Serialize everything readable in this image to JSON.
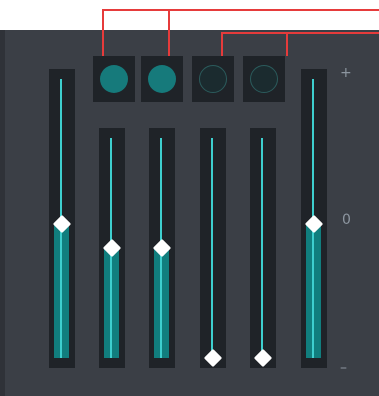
{
  "scale": {
    "plus": "+",
    "zero": "0",
    "minus": "–"
  },
  "leds": [
    {
      "state": "on"
    },
    {
      "state": "on"
    },
    {
      "state": "off"
    },
    {
      "state": "off"
    }
  ],
  "sliders": [
    {
      "value": 0.48
    },
    {
      "value": 0.5
    },
    {
      "value": 0.5
    },
    {
      "value": 0.0
    },
    {
      "value": 0.0
    },
    {
      "value": 0.48
    }
  ],
  "colors": {
    "background": "#3b3f46",
    "track": "#1f2328",
    "fill": "#117e7e",
    "line": "#3ecfcf",
    "thumb": "#ffffff",
    "connector": "#e63b3b",
    "led_on": "#167a7b",
    "led_off_border": "#2b5b5c"
  },
  "icons": {
    "thumb": "diamond-thumb-icon",
    "led": "circle-led-icon"
  }
}
